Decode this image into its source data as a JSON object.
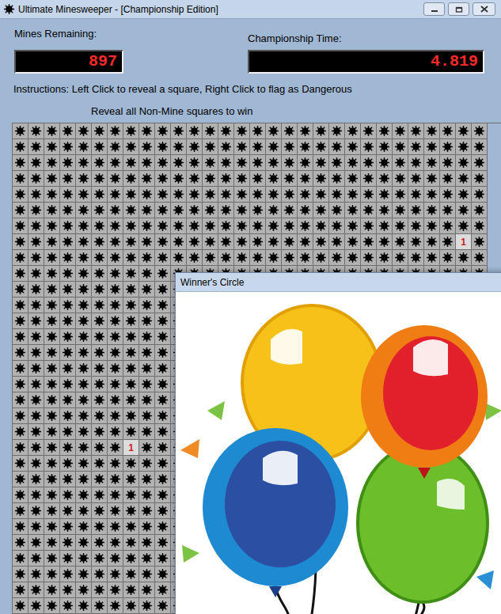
{
  "window": {
    "title": "Ultimate Minesweeper - [Championship Edition]"
  },
  "counters": [
    {
      "label": "Mines Remaining:",
      "value": "897"
    },
    {
      "label": "Championship Time:",
      "value": "4.819"
    }
  ],
  "instructions": "Instructions: Left Click to reveal a square, Right Click to flag as Dangerous",
  "goal": "Reveal all Non-Mine squares to win",
  "board": {
    "rows": 31,
    "columns": 30,
    "revealed": [
      {
        "row": 7,
        "column": 28,
        "text": "1"
      },
      {
        "row": 20,
        "column": 7,
        "text": "1"
      }
    ]
  },
  "dialog": {
    "title": "Winner's Circle"
  }
}
